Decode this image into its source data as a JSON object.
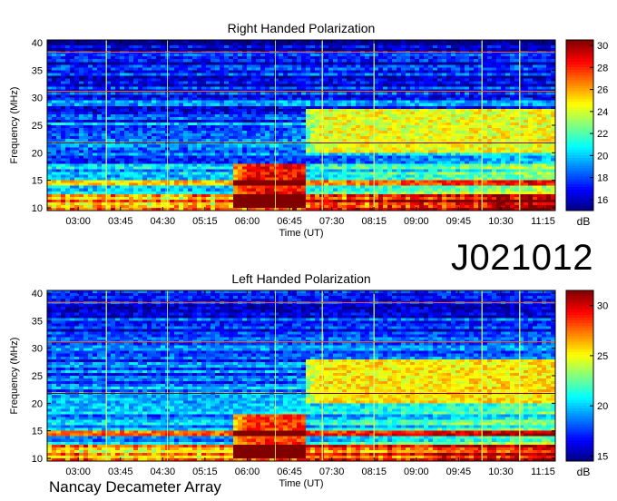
{
  "observation_id": "J021012",
  "observatory": "Nancay Decameter Array",
  "chart_data": [
    {
      "type": "heatmap",
      "title": "Right Handed Polarization",
      "xlabel": "Time (UT)",
      "ylabel": "Frequency (MHz)",
      "x_ticks": [
        "03:00",
        "03:45",
        "04:30",
        "05:15",
        "06:00",
        "06:45",
        "07:30",
        "08:15",
        "09:00",
        "09:45",
        "10:30",
        "11:15"
      ],
      "xlim": [
        "02:27",
        "11:28"
      ],
      "y_ticks": [
        10,
        15,
        20,
        25,
        30,
        35,
        40
      ],
      "ylim": [
        9.5,
        40.5
      ],
      "colorbar": {
        "label": "dB",
        "ticks": [
          16,
          18,
          20,
          22,
          24,
          26,
          28,
          30
        ],
        "range": [
          15,
          30.5
        ],
        "colormap": "jet"
      },
      "bright_vertical_lines": [
        "03:30",
        "04:35",
        "06:30",
        "07:20",
        "08:15",
        "10:10",
        "10:50"
      ],
      "emission_features": [
        {
          "name": "strong burst",
          "time": [
            "05:45",
            "07:00"
          ],
          "freq_mhz": [
            10,
            18
          ],
          "level_db": 30
        },
        {
          "name": "extended band",
          "time": [
            "07:00",
            "11:28"
          ],
          "freq_mhz": [
            20,
            28
          ],
          "level_db": 26
        }
      ]
    },
    {
      "type": "heatmap",
      "title": "Left Handed Polarization",
      "xlabel": "Time (UT)",
      "ylabel": "Frequency (MHz)",
      "x_ticks": [
        "03:00",
        "03:45",
        "04:30",
        "05:15",
        "06:00",
        "06:45",
        "07:30",
        "08:15",
        "09:00",
        "09:45",
        "10:30",
        "11:15"
      ],
      "xlim": [
        "02:27",
        "11:28"
      ],
      "y_ticks": [
        10,
        15,
        20,
        25,
        30,
        35,
        40
      ],
      "ylim": [
        9.5,
        40.5
      ],
      "colorbar": {
        "label": "dB",
        "ticks": [
          15,
          20,
          25,
          30
        ],
        "range": [
          14.5,
          31.5
        ],
        "colormap": "jet"
      },
      "bright_vertical_lines": [
        "03:30",
        "04:35",
        "06:30",
        "07:20",
        "08:15",
        "10:10",
        "10:50"
      ],
      "emission_features": [
        {
          "name": "strong burst",
          "time": [
            "05:45",
            "07:00"
          ],
          "freq_mhz": [
            10,
            18
          ],
          "level_db": 30
        },
        {
          "name": "extended band",
          "time": [
            "07:00",
            "11:28"
          ],
          "freq_mhz": [
            20,
            28
          ],
          "level_db": 27
        }
      ]
    }
  ]
}
